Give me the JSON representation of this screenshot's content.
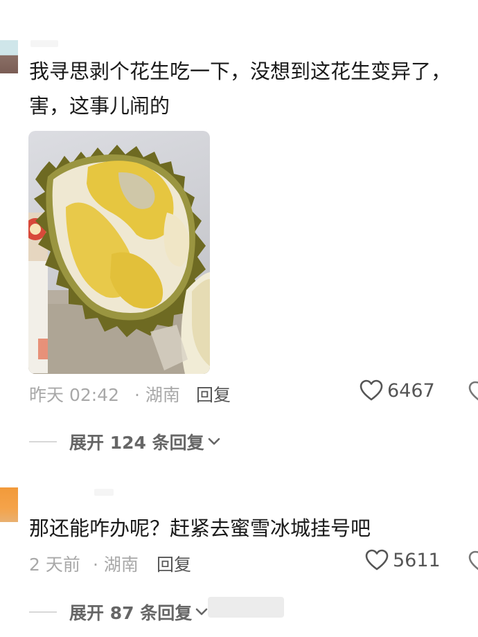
{
  "comments": [
    {
      "text": "我寻思剥个花生吃一下，没想到这花生变异了，\n害，这事儿闹的",
      "time": "昨天 02:42",
      "location": "· 湖南",
      "reply_label": "回复",
      "likes": "6467",
      "expand_label": "展开 124 条回复"
    },
    {
      "text": "那还能咋办呢？赶紧去蜜雪冰城挂号吧",
      "time": "2 天前",
      "location": "· 湖南",
      "reply_label": "回复",
      "likes": "5611",
      "expand_label": "展开 87 条回复"
    }
  ],
  "icons": {
    "like": "heart-outline-icon",
    "expand": "chevron-down-icon"
  },
  "colors": {
    "text": "#1a1a1a",
    "meta": "#a8a8a8",
    "photo_flesh": "#e8c84a",
    "photo_husk": "#8a8a2a"
  }
}
